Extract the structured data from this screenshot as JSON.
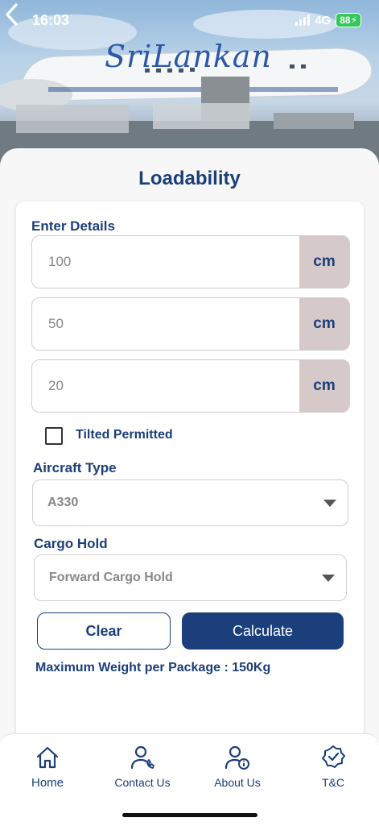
{
  "status_bar": {
    "time": "16:03",
    "network": "4G",
    "battery": "88"
  },
  "hero": {
    "brand": "SriLankan"
  },
  "page": {
    "title": "Loadability"
  },
  "form": {
    "section_label": "Enter Details",
    "dimensions": [
      {
        "value": "100",
        "unit": "cm"
      },
      {
        "value": "50",
        "unit": "cm"
      },
      {
        "value": "20",
        "unit": "cm"
      }
    ],
    "tilted_label": "Tilted Permitted",
    "tilted_checked": false,
    "aircraft_label": "Aircraft Type",
    "aircraft_value": "A330",
    "cargo_label": "Cargo Hold",
    "cargo_value": "Forward Cargo Hold",
    "clear_label": "Clear",
    "calculate_label": "Calculate",
    "max_weight": "Maximum Weight per Package : 150Kg"
  },
  "nav": {
    "items": [
      {
        "label": "Home",
        "icon": "home-icon"
      },
      {
        "label": "Contact Us",
        "icon": "contact-icon"
      },
      {
        "label": "About Us",
        "icon": "about-icon"
      },
      {
        "label": "T&C",
        "icon": "badge-check-icon"
      }
    ]
  },
  "colors": {
    "primary": "#1b3f7a",
    "unit_bg": "#d5c9c9"
  }
}
